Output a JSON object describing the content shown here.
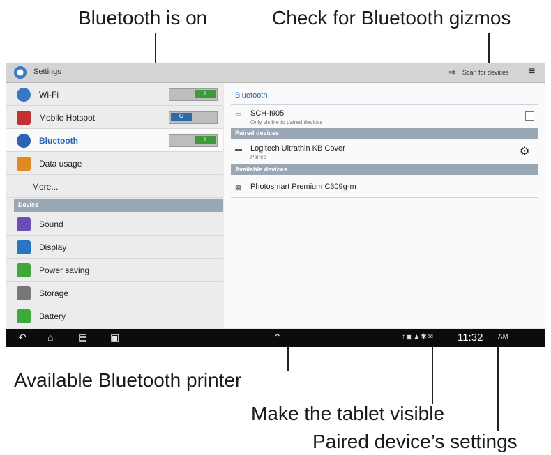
{
  "callouts": {
    "bluetooth_on": "Bluetooth is on",
    "check_gizmos": "Check for Bluetooth gizmos",
    "available_printer": "Available Bluetooth printer",
    "make_visible": "Make the tablet visible",
    "paired_settings": "Paired device’s settings"
  },
  "titlebar": {
    "title": "Settings",
    "scan_label": "Scan for devices",
    "scan_icon": "bluetooth-scan-icon",
    "menu_icon": "overflow-menu-icon"
  },
  "sidebar": {
    "items": [
      {
        "label": "Wi-Fi",
        "icon": "wifi-icon",
        "toggle": "on"
      },
      {
        "label": "Mobile Hotspot",
        "icon": "hotspot-icon",
        "toggle": "off"
      },
      {
        "label": "Bluetooth",
        "icon": "bluetooth-icon",
        "toggle": "on",
        "selected": true
      },
      {
        "label": "Data usage",
        "icon": "data-usage-icon"
      },
      {
        "label": "More...",
        "icon": ""
      }
    ],
    "section_device": "Device",
    "device_items": [
      {
        "label": "Sound",
        "icon": "sound-icon"
      },
      {
        "label": "Display",
        "icon": "display-icon"
      },
      {
        "label": "Power saving",
        "icon": "power-saving-icon"
      },
      {
        "label": "Storage",
        "icon": "storage-icon"
      },
      {
        "label": "Battery",
        "icon": "battery-icon"
      }
    ],
    "toggle_on_label": "I",
    "toggle_off_label": "O"
  },
  "detail": {
    "heading": "Bluetooth",
    "this_device": {
      "name": "SCH-I905",
      "sub": "Only visible to paired devices"
    },
    "paired_heading": "Paired devices",
    "paired": {
      "name": "Logitech Ultrathin KB Cover",
      "sub": "Paired"
    },
    "available_heading": "Available devices",
    "available": {
      "name": "Photosmart Premium C309g-m"
    }
  },
  "navbar": {
    "time": "11:32",
    "ampm": "AM"
  },
  "colors": {
    "accent": "#2a64b4",
    "section": "#9aa7b5",
    "toggle_on": "#3f9a3a",
    "toggle_off": "#2c6aa8"
  }
}
